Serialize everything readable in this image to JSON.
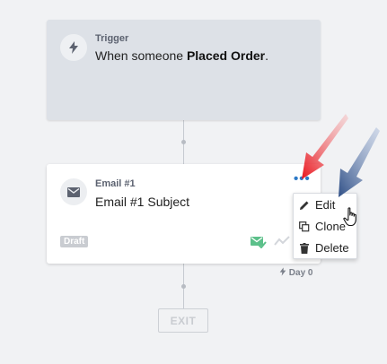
{
  "trigger": {
    "label": "Trigger",
    "text_prefix": "When someone ",
    "event": "Placed Order",
    "text_suffix": ".",
    "icon": "lightning-bolt-icon"
  },
  "email": {
    "label": "Email #1",
    "subject": "Email #1 Subject",
    "status": "Draft",
    "icon": "envelope-icon",
    "more_label": "•••"
  },
  "delay": {
    "label": "Day 0",
    "icon": "lightning-bolt-icon"
  },
  "exit": {
    "label": "EXIT"
  },
  "menu": {
    "items": [
      {
        "label": "Edit",
        "icon": "pencil-icon"
      },
      {
        "label": "Clone",
        "icon": "clone-icon"
      },
      {
        "label": "Delete",
        "icon": "trash-icon"
      }
    ]
  },
  "colors": {
    "accent": "#2c79c7",
    "success": "#5cc08a",
    "annotation_red": "#e8141c",
    "annotation_navy": "#2f4f86"
  }
}
